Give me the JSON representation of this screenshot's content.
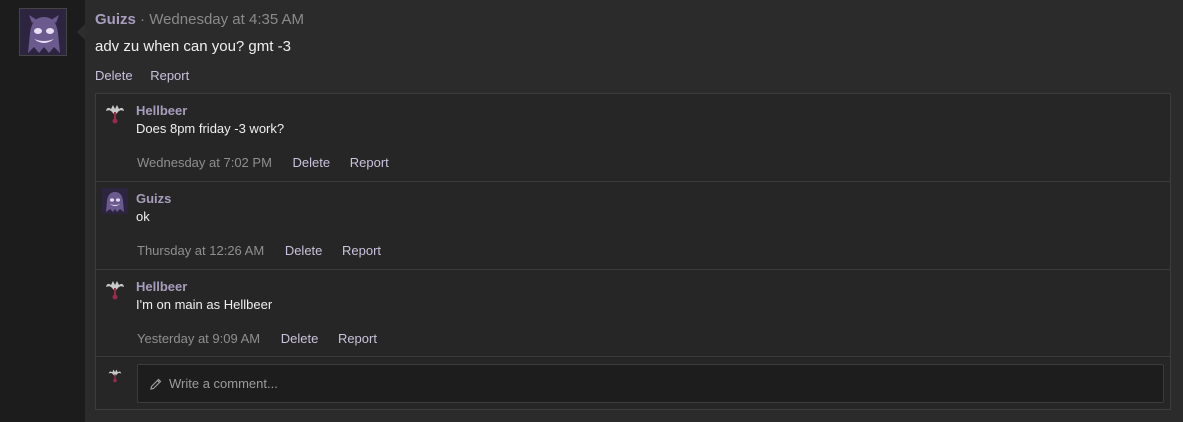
{
  "post": {
    "author": "Guizs",
    "separator": "·",
    "timestamp": "Wednesday at 4:35 AM",
    "body": "adv zu when can you? gmt -3",
    "actions": {
      "delete": "Delete",
      "report": "Report"
    }
  },
  "comments": [
    {
      "author": "Hellbeer",
      "avatar_icon": "bat-icon",
      "body": "Does 8pm friday -3 work?",
      "timestamp": "Wednesday at 7:02 PM",
      "delete": "Delete",
      "report": "Report"
    },
    {
      "author": "Guizs",
      "avatar_icon": "ghost-icon",
      "body": "ok",
      "timestamp": "Thursday at 12:26 AM",
      "delete": "Delete",
      "report": "Report"
    },
    {
      "author": "Hellbeer",
      "avatar_icon": "bat-icon",
      "body": "I'm on main as Hellbeer",
      "timestamp": "Yesterday at 9:09 AM",
      "delete": "Delete",
      "report": "Report"
    }
  ],
  "new_comment": {
    "placeholder": "Write a comment...",
    "icon": "pencil-icon"
  },
  "colors": {
    "accent": "#a79dbd",
    "background": "#2b2b2b",
    "muted": "#8f8f8f"
  }
}
